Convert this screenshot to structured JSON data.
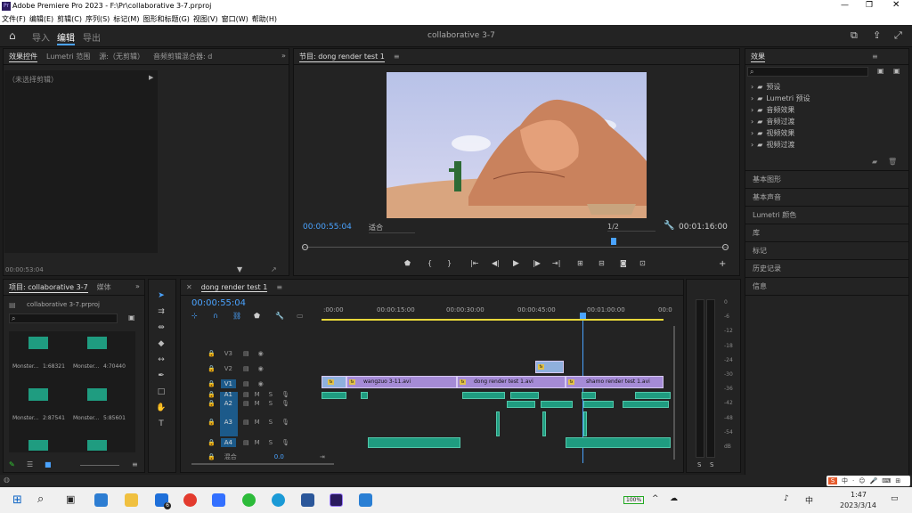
{
  "window": {
    "title": "Adobe Premiere Pro 2023 - F:\\Pr\\collaborative 3-7.prproj"
  },
  "menu": [
    "文件(F)",
    "编辑(E)",
    "剪辑(C)",
    "序列(S)",
    "标记(M)",
    "图形和标题(G)",
    "视图(V)",
    "窗口(W)",
    "帮助(H)"
  ],
  "header": {
    "tabs": [
      "导入",
      "编辑",
      "导出"
    ],
    "active": "编辑",
    "project_title": "collaborative 3-7"
  },
  "source_panel": {
    "tabs": [
      "效果控件",
      "Lumetri 范围",
      "源:（无剪辑）",
      "音频剪辑混合器: d"
    ],
    "no_clip": "（未选择剪辑）",
    "timecode": "00:00:53:04"
  },
  "program": {
    "tab": "节目: dong render test 1",
    "timecode": "00:00:55:04",
    "fit": "适合",
    "resolution": "1/2",
    "duration": "00:01:16:00"
  },
  "project": {
    "tabs": [
      "项目: collaborative 3-7",
      "媒体"
    ],
    "file": "collaborative 3-7.prproj",
    "items": [
      {
        "name": "Monster...",
        "dur": "1:68321"
      },
      {
        "name": "Monster...",
        "dur": "4:70440"
      },
      {
        "name": "Monster...",
        "dur": "2:87541"
      },
      {
        "name": "Monster...",
        "dur": "5:85601"
      }
    ]
  },
  "timeline": {
    "tab": "dong render test 1",
    "timecode": "00:00:55:04",
    "ruler": [
      ":00:00",
      "00:00:15:00",
      "00:00:30:00",
      "00:00:45:00",
      "00:01:00:00",
      "00:0"
    ],
    "clips": [
      "wangzuo 3-11.avi",
      "dong render test 1.avi",
      "shamo render test 1.avi"
    ],
    "tracks": [
      "V3",
      "V2",
      "V1",
      "A1",
      "A2",
      "A3",
      "A4"
    ],
    "mix_label": "混合",
    "mix_value": "0.0"
  },
  "meter": {
    "scale": [
      "0",
      "-6",
      "-12",
      "-18",
      "-24",
      "-30",
      "-36",
      "-42",
      "-48",
      "-54",
      "dB"
    ],
    "solo": [
      "S",
      "S"
    ]
  },
  "effects": {
    "title": "效果",
    "folders": [
      "预设",
      "Lumetri 预设",
      "音频效果",
      "音频过渡",
      "视频效果",
      "视频过渡"
    ],
    "sections": [
      "基本图形",
      "基本声音",
      "Lumetri 颜色",
      "库",
      "标记",
      "历史记录",
      "信息"
    ]
  },
  "taskbar": {
    "time": "1:47",
    "date": "2023/3/14",
    "battery": "100%",
    "ime": "中",
    "mail_badge": "6"
  }
}
